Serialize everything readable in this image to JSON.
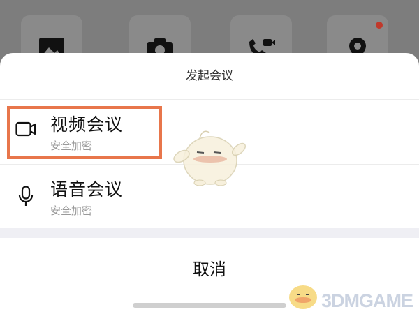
{
  "background_tiles": [
    {
      "icon": "image-icon"
    },
    {
      "icon": "camera-icon"
    },
    {
      "icon": "video-call-icon"
    },
    {
      "icon": "location-icon"
    }
  ],
  "sheet": {
    "title": "发起会议",
    "options": [
      {
        "title": "视频会议",
        "subtitle": "安全加密",
        "icon": "video-camera-icon",
        "highlighted": true
      },
      {
        "title": "语音会议",
        "subtitle": "安全加密",
        "icon": "microphone-icon",
        "highlighted": false
      }
    ],
    "cancel_label": "取消"
  },
  "watermark": {
    "text": "3DMGAME"
  },
  "colors": {
    "highlight": "#e8764b",
    "overlay": "#7d7d7d",
    "badge": "#c0392b"
  }
}
